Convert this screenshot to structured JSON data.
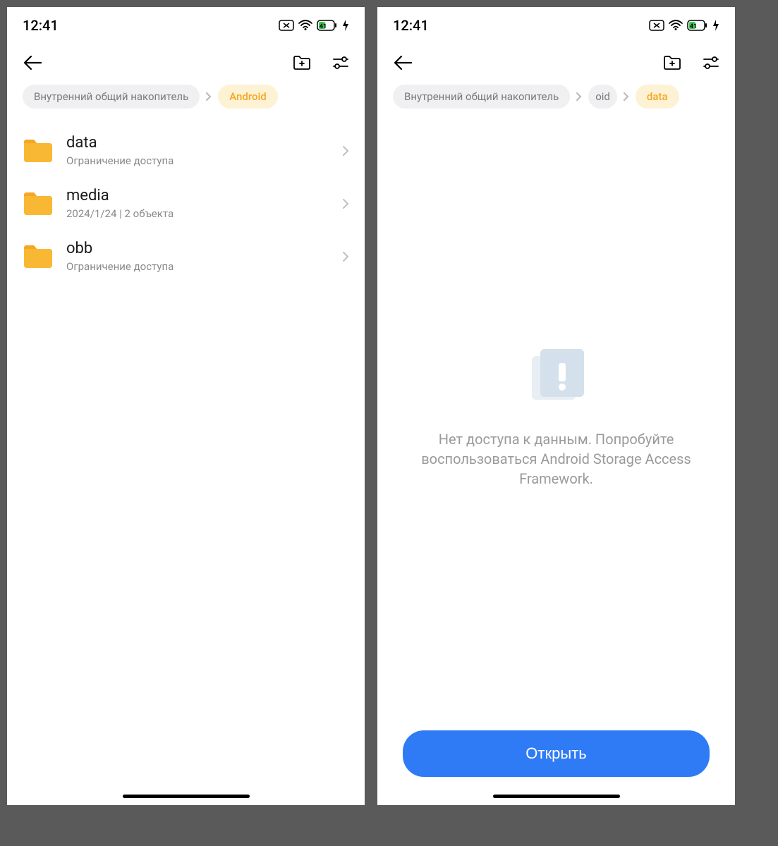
{
  "status": {
    "time": "12:41",
    "battery_level": "41"
  },
  "left": {
    "breadcrumb": {
      "root": "Внутренний общий накопитель",
      "current": "Android"
    },
    "folders": [
      {
        "name": "data",
        "sub": "Ограничение доступа"
      },
      {
        "name": "media",
        "sub": "2024/1/24  |  2 объекта"
      },
      {
        "name": "obb",
        "sub": "Ограничение доступа"
      }
    ]
  },
  "right": {
    "breadcrumb": {
      "root": "Внутренний общий накопитель",
      "mid": "oid",
      "current": "data"
    },
    "empty_message": "Нет доступа к данным. Попробуйте воспользоваться Android Storage Access Framework.",
    "open_button": "Открыть"
  }
}
